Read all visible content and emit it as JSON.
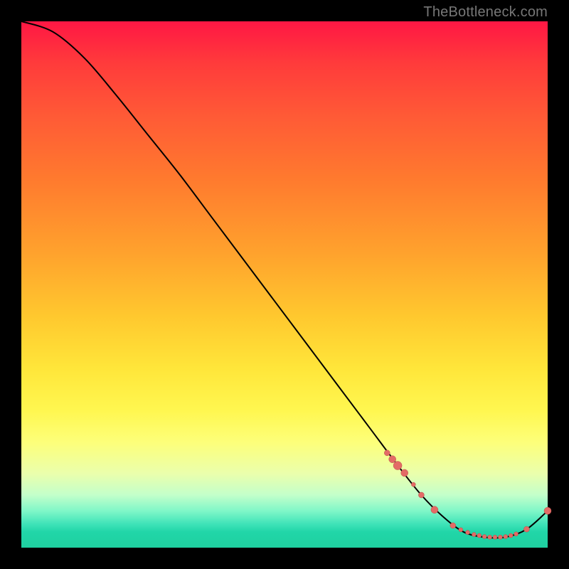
{
  "watermark": "TheBottleneck.com",
  "colors": {
    "point_fill": "#e36b66",
    "point_stroke": "#b84f49",
    "curve_stroke": "#000000",
    "background": "#000000"
  },
  "chart_data": {
    "type": "line",
    "title": "",
    "xlabel": "",
    "ylabel": "",
    "xlim": [
      0,
      100
    ],
    "ylim": [
      0,
      100
    ],
    "grid": false,
    "curve": {
      "x": [
        0,
        6,
        12,
        18,
        24,
        30,
        36,
        42,
        48,
        54,
        60,
        66,
        72,
        76,
        80,
        84,
        88,
        92,
        96,
        100
      ],
      "y": [
        100,
        98,
        93,
        86,
        78.5,
        71,
        63,
        55,
        47,
        39,
        31,
        23,
        15,
        10,
        6,
        3,
        2,
        2,
        3.5,
        7
      ]
    },
    "points": [
      {
        "x": 69.5,
        "y": 18.0,
        "r": 4
      },
      {
        "x": 70.5,
        "y": 16.8,
        "r": 5
      },
      {
        "x": 71.5,
        "y": 15.6,
        "r": 6
      },
      {
        "x": 72.8,
        "y": 14.2,
        "r": 5
      },
      {
        "x": 74.5,
        "y": 12.0,
        "r": 3
      },
      {
        "x": 76.0,
        "y": 10.0,
        "r": 4
      },
      {
        "x": 78.5,
        "y": 7.2,
        "r": 5
      },
      {
        "x": 82.0,
        "y": 4.2,
        "r": 4
      },
      {
        "x": 83.5,
        "y": 3.4,
        "r": 3
      },
      {
        "x": 84.8,
        "y": 2.9,
        "r": 3
      },
      {
        "x": 86.0,
        "y": 2.5,
        "r": 3
      },
      {
        "x": 87.0,
        "y": 2.3,
        "r": 3
      },
      {
        "x": 88.0,
        "y": 2.1,
        "r": 3
      },
      {
        "x": 89.0,
        "y": 2.0,
        "r": 3
      },
      {
        "x": 90.0,
        "y": 2.0,
        "r": 3
      },
      {
        "x": 91.0,
        "y": 2.0,
        "r": 3
      },
      {
        "x": 92.0,
        "y": 2.1,
        "r": 3
      },
      {
        "x": 93.0,
        "y": 2.3,
        "r": 3
      },
      {
        "x": 94.0,
        "y": 2.6,
        "r": 3
      },
      {
        "x": 96.0,
        "y": 3.5,
        "r": 4
      },
      {
        "x": 100.0,
        "y": 7.0,
        "r": 5
      }
    ]
  }
}
